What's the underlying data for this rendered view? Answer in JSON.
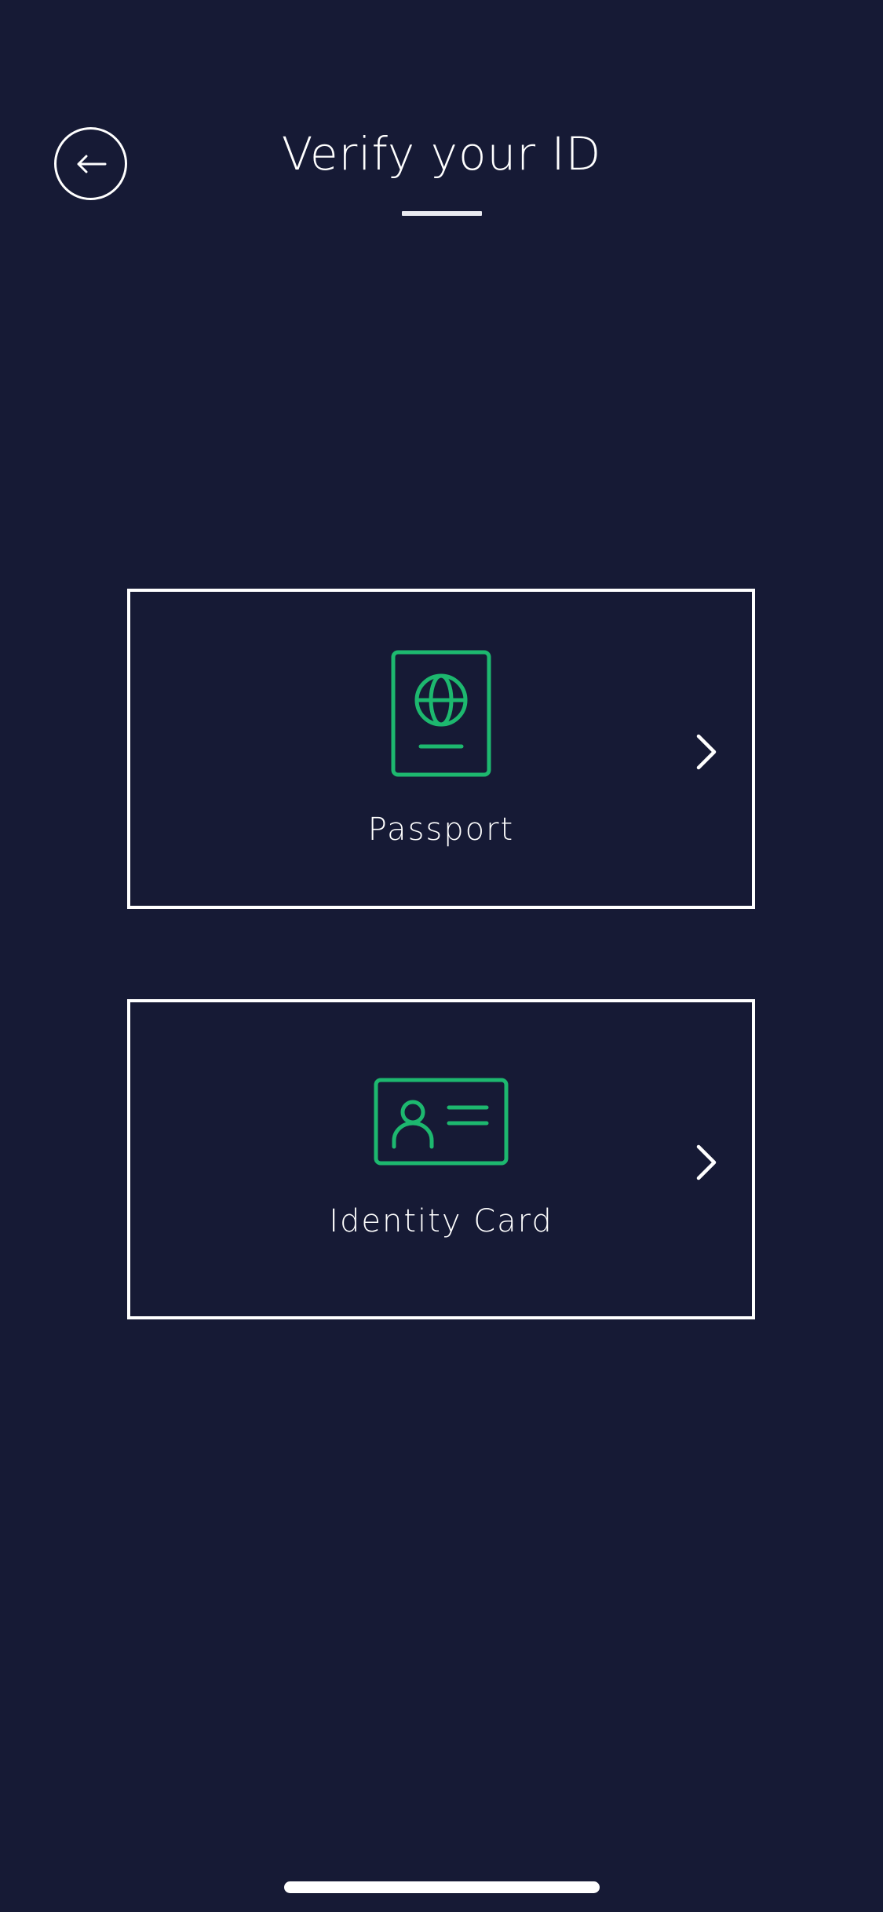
{
  "header": {
    "title": "Verify your ID",
    "back_icon": "arrow-left-icon"
  },
  "options": [
    {
      "label": "Passport",
      "icon": "passport-icon"
    },
    {
      "label": "Identity Card",
      "icon": "id-card-icon"
    }
  ],
  "colors": {
    "background": "#161a35",
    "accent": "#1db86f",
    "foreground": "#ffffff"
  }
}
